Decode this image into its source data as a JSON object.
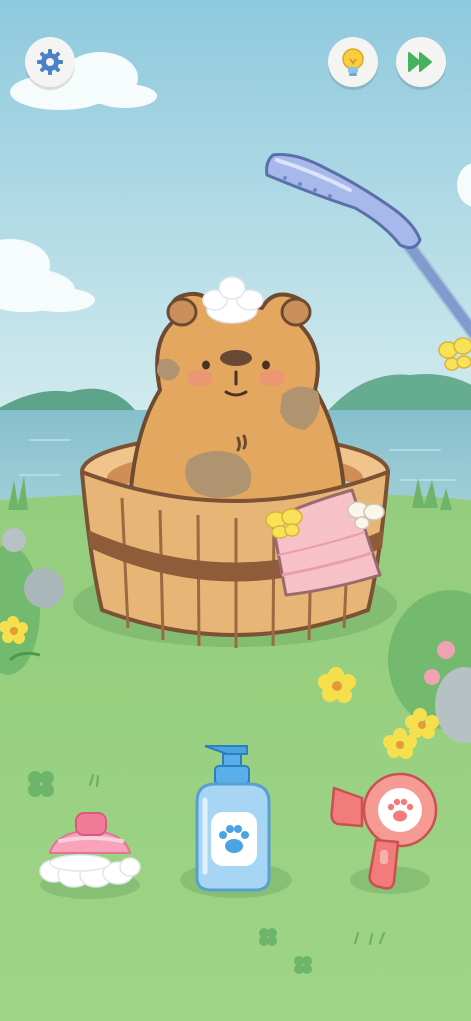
{
  "toolbar": {
    "settings_icon": "gear-icon",
    "hint_icon": "lightbulb-icon",
    "skip_icon": "fast-forward-icon"
  },
  "scene": {
    "character": "capybara",
    "tub": "wooden-bath-tub",
    "accessories": [
      "soap-foam",
      "pink-towel",
      "yellow-butterfly",
      "white-butterfly"
    ]
  },
  "tools": [
    {
      "name": "brush",
      "icon": "pink-brush-icon"
    },
    {
      "name": "shampoo",
      "icon": "shampoo-bottle-icon"
    },
    {
      "name": "hair-dryer",
      "icon": "hair-dryer-icon"
    },
    {
      "name": "shower-head",
      "icon": "shower-head-icon"
    }
  ],
  "colors": {
    "sky_top": "#8ec9dd",
    "sky_bottom": "#cfe9ec",
    "water": "#7fb9c8",
    "grass": "#95cf7f",
    "capybara": "#e3a75f",
    "tub": "#e7b575",
    "towel": "#f6c2c8",
    "bottle": "#a6d6f4"
  }
}
